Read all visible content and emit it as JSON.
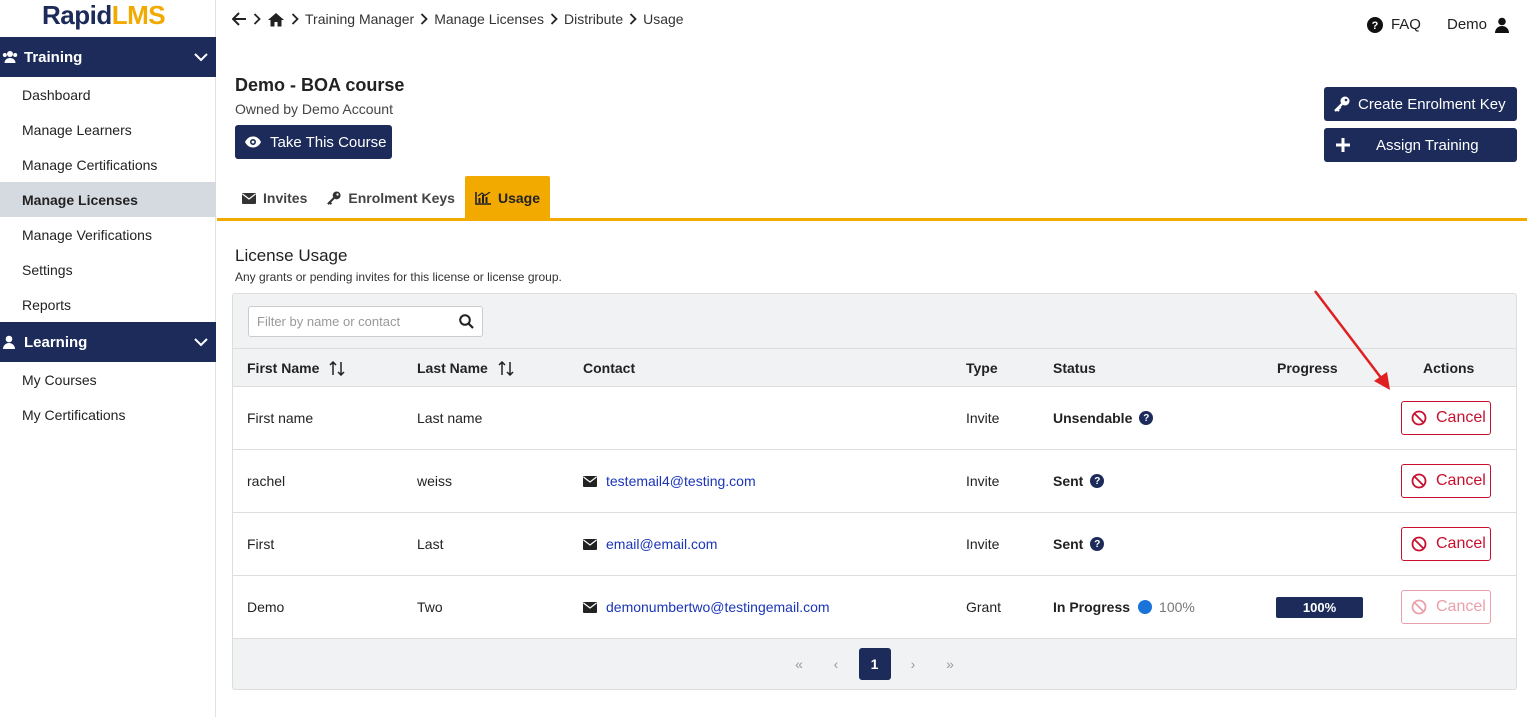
{
  "brand": {
    "name_a": "Rapid",
    "name_b": "LMS"
  },
  "sidebar": {
    "training": {
      "label": "Training",
      "items": [
        "Dashboard",
        "Manage Learners",
        "Manage Certifications",
        "Manage Licenses",
        "Manage Verifications",
        "Settings",
        "Reports"
      ],
      "active": "Manage Licenses"
    },
    "learning": {
      "label": "Learning",
      "items": [
        "My Courses",
        "My Certifications"
      ]
    }
  },
  "breadcrumb": [
    "Training Manager",
    "Manage Licenses",
    "Distribute",
    "Usage"
  ],
  "header": {
    "faq": "FAQ",
    "user": "Demo"
  },
  "course": {
    "title": "Demo - BOA course",
    "owner": "Owned by Demo Account",
    "take_label": "Take This Course",
    "create_key_label": "Create Enrolment Key",
    "assign_label": "Assign Training"
  },
  "tabs": [
    "Invites",
    "Enrolment Keys",
    "Usage"
  ],
  "active_tab": "Usage",
  "panel": {
    "title": "License Usage",
    "subtitle": "Any grants or pending invites for this license or license group.",
    "filter_placeholder": "Filter by name or contact"
  },
  "table": {
    "columns": [
      "First Name",
      "Last Name",
      "Contact",
      "Type",
      "Status",
      "Progress",
      "Actions"
    ],
    "rows": [
      {
        "first": "First name",
        "last": "Last name",
        "contact": "",
        "type": "Invite",
        "status": "Unsendable",
        "progress": "",
        "action": "Cancel"
      },
      {
        "first": "rachel",
        "last": "weiss",
        "contact": "testemail4@testing.com",
        "type": "Invite",
        "status": "Sent",
        "progress": "",
        "action": "Cancel"
      },
      {
        "first": "First",
        "last": "Last",
        "contact": "email@email.com",
        "type": "Invite",
        "status": "Sent",
        "progress": "",
        "action": "Cancel"
      },
      {
        "first": "Demo",
        "last": "Two",
        "contact": "demonumbertwo@testingemail.com",
        "type": "Grant",
        "status": "In Progress",
        "status_pct": "100%",
        "progress": "100%",
        "action": "Cancel"
      }
    ]
  },
  "pager": {
    "first": "«",
    "prev": "‹",
    "current": "1",
    "next": "›",
    "last": "»"
  },
  "colors": {
    "navy": "#1c2b5a",
    "accent": "#f2a900",
    "danger": "#c8102e",
    "link": "#1a35b8"
  }
}
